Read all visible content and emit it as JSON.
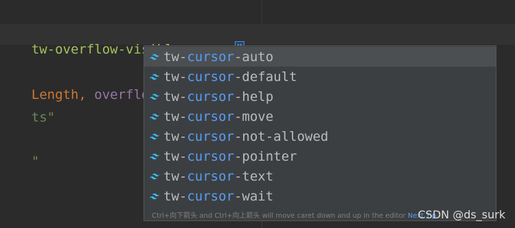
{
  "editor": {
    "line1": {
      "attr_text": "tw-overflow-visible cursor",
      "close_quote": "\"",
      "tag_end": ">"
    },
    "line2": {
      "part1": "Length, ",
      "part2": "overflow:"
    },
    "line3": {
      "text": "ts\""
    },
    "line4": {
      "text": "\""
    }
  },
  "completion_popup": {
    "items": [
      {
        "prefix": "tw-",
        "match": "cursor",
        "suffix": "-auto"
      },
      {
        "prefix": "tw-",
        "match": "cursor",
        "suffix": "-default"
      },
      {
        "prefix": "tw-",
        "match": "cursor",
        "suffix": "-help"
      },
      {
        "prefix": "tw-",
        "match": "cursor",
        "suffix": "-move"
      },
      {
        "prefix": "tw-",
        "match": "cursor",
        "suffix": "-not-allowed"
      },
      {
        "prefix": "tw-",
        "match": "cursor",
        "suffix": "-pointer"
      },
      {
        "prefix": "tw-",
        "match": "cursor",
        "suffix": "-text"
      },
      {
        "prefix": "tw-",
        "match": "cursor",
        "suffix": "-wait"
      }
    ],
    "footer": {
      "hint": "Ctrl+向下箭头 and Ctrl+向上箭头 will move caret down and up in the editor",
      "next_tip": "Next Tip"
    },
    "icon": "tailwind-icon"
  },
  "watermark": "CSDN @ds_surk",
  "colors": {
    "background": "#2b2b2b",
    "popup_background": "#3c3f41",
    "selected_item": "#4b4f52",
    "match_highlight": "#589df6",
    "attribute_green": "#a5c25c",
    "tailwind_cyan": "#38bdf8"
  }
}
